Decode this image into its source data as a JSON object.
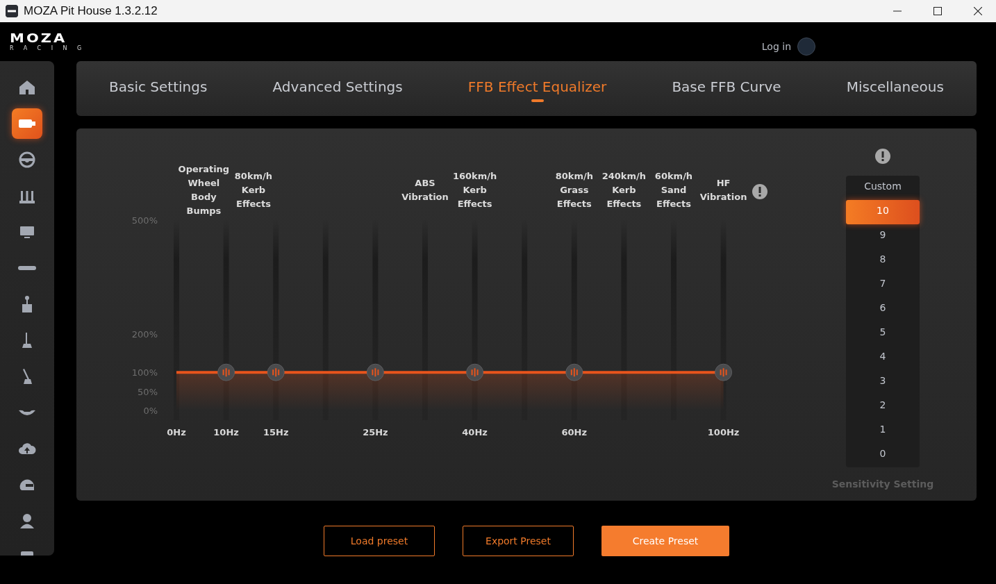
{
  "window": {
    "title": "MOZA Pit House 1.3.2.12"
  },
  "header": {
    "logo": {
      "wordmark": "MOZA",
      "tagline": "RACING"
    },
    "login": "Log in"
  },
  "sidebar": {
    "items": [
      {
        "kind": "home",
        "selected": false
      },
      {
        "kind": "base",
        "selected": true
      },
      {
        "kind": "wheel",
        "selected": false
      },
      {
        "kind": "pedals",
        "selected": false
      },
      {
        "kind": "display",
        "selected": false
      },
      {
        "kind": "bar",
        "selected": false
      },
      {
        "kind": "shifter",
        "selected": false
      },
      {
        "kind": "sequential",
        "selected": false
      },
      {
        "kind": "handbrake",
        "selected": false
      },
      {
        "kind": "hub",
        "selected": false
      },
      {
        "kind": "cloud",
        "selected": false
      },
      {
        "kind": "helmet",
        "selected": false
      },
      {
        "kind": "user",
        "selected": false
      },
      {
        "kind": "device",
        "selected": false
      }
    ]
  },
  "tabs": [
    {
      "label": "Basic Settings",
      "selected": false
    },
    {
      "label": "Advanced Settings",
      "selected": false
    },
    {
      "label": "FFB Effect Equalizer",
      "selected": true
    },
    {
      "label": "Base FFB Curve",
      "selected": false
    },
    {
      "label": "Miscellaneous",
      "selected": false
    }
  ],
  "equalizer": {
    "effect_labels": [
      "Operating Wheel Body Bumps",
      "80km/h Kerb Effects",
      "ABS Vibration",
      "160km/h Kerb Effects",
      "80km/h Grass Effects",
      "240km/h Kerb Effects",
      "60km/h Sand Effects",
      "HF Vibration"
    ],
    "chart_data": {
      "type": "area",
      "grid": true,
      "categories": [
        "0Hz",
        "10Hz",
        "15Hz",
        "25Hz",
        "40Hz",
        "60Hz",
        "100Hz"
      ],
      "series": [
        {
          "color": "#e8541c",
          "marker": true,
          "values": [
            100,
            100,
            100,
            100,
            100,
            100,
            100
          ]
        }
      ],
      "ylim": [
        0,
        500
      ],
      "yticks": [
        {
          "value": 0,
          "label": "0%"
        },
        {
          "value": 50,
          "label": "50%"
        },
        {
          "value": 100,
          "label": "100%"
        },
        {
          "value": 200,
          "label": "200%"
        },
        {
          "value": 500,
          "label": "500%"
        }
      ]
    }
  },
  "sensitivity": {
    "options": [
      {
        "label": "Custom",
        "selected": false
      },
      {
        "label": "10",
        "selected": true
      },
      {
        "label": "9",
        "selected": false
      },
      {
        "label": "8",
        "selected": false
      },
      {
        "label": "7",
        "selected": false
      },
      {
        "label": "6",
        "selected": false
      },
      {
        "label": "5",
        "selected": false
      },
      {
        "label": "4",
        "selected": false
      },
      {
        "label": "3",
        "selected": false
      },
      {
        "label": "2",
        "selected": false
      },
      {
        "label": "1",
        "selected": false
      },
      {
        "label": "0",
        "selected": false
      }
    ],
    "caption": "Sensitivity Setting"
  },
  "buttons": [
    {
      "label": "Load preset",
      "kind": "outline"
    },
    {
      "label": "Export Preset",
      "kind": "outline"
    },
    {
      "label": "Create Preset",
      "kind": "primary"
    }
  ]
}
